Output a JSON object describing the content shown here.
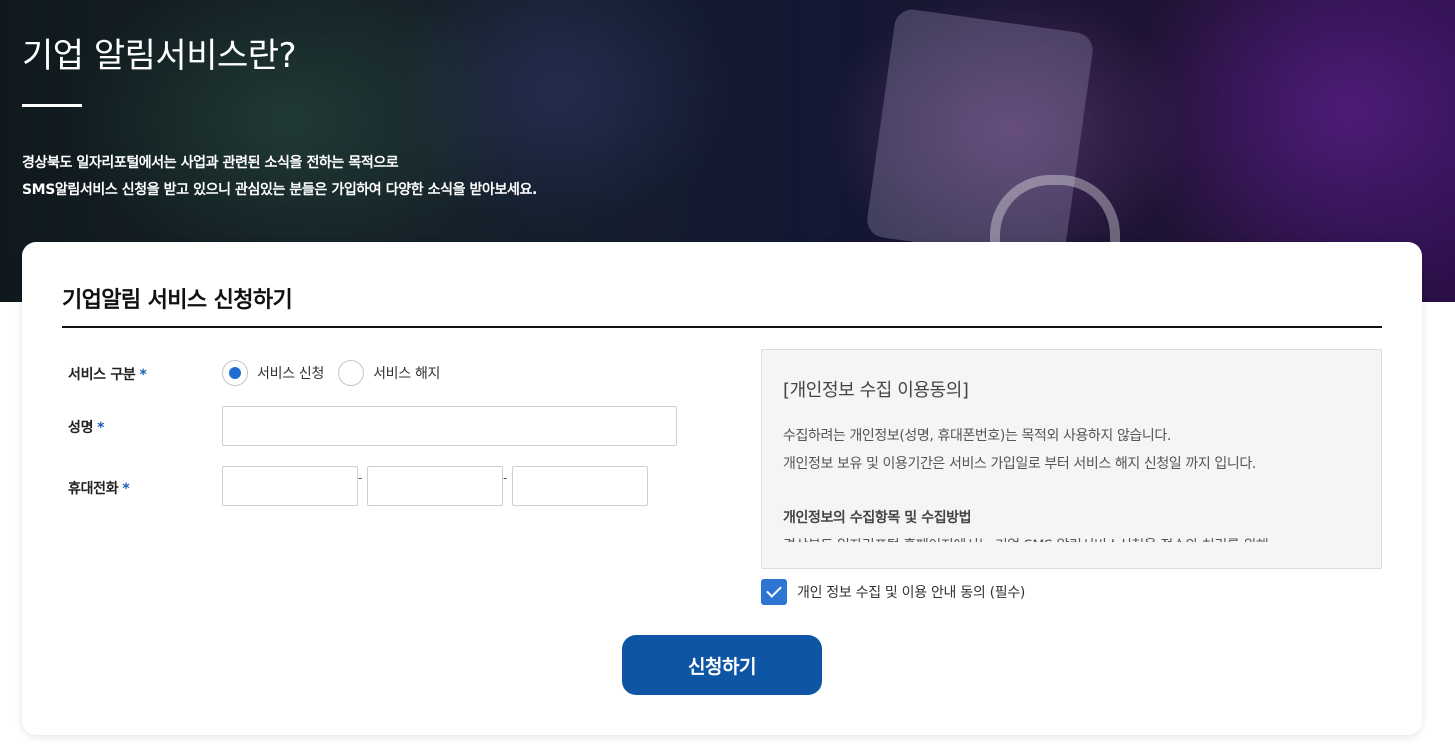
{
  "hero": {
    "title": "기업 알림서비스란?",
    "desc_line1": "경상북도 일자리포털에서는 사업과 관련된 소식을 전하는 목적으로",
    "desc_line2": "SMS알림서비스 신청을 받고 있으니 관심있는 분들은 가입하여 다양한 소식을 받아보세요."
  },
  "form": {
    "title": "기업알림 서비스 신청하기",
    "required_mark": "*",
    "service_type_label": "서비스 구분",
    "service_options": [
      {
        "label": "서비스 신청",
        "selected": true
      },
      {
        "label": "서비스 해지",
        "selected": false
      }
    ],
    "name_label": "성명",
    "name_value": "",
    "phone_label": "휴대전화",
    "phone_parts": [
      "",
      "",
      ""
    ],
    "phone_separator": "-",
    "submit_label": "신청하기"
  },
  "consent": {
    "heading": "[개인정보 수집 이용동의]",
    "lines": [
      "수집하려는 개인정보(성명, 휴대폰번호)는 목적외 사용하지 않습니다.",
      "개인정보 보유 및 이용기간은 서비스 가입일로 부터 서비스 해지 신청일 까지 입니다."
    ],
    "subheading": "개인정보의 수집항목 및 수집방법",
    "partial_line": "경상북도 일자리포털 홈페이지에서는 기업 SMS 알림서비스신청을 접수와 처리를 위해",
    "checkbox_label": "개인 정보 수집 및 이용 안내 동의 (필수)",
    "checked": true
  },
  "colors": {
    "accent": "#0e56a4",
    "checkbox": "#2d74d3",
    "required": "#1c5fb5"
  }
}
